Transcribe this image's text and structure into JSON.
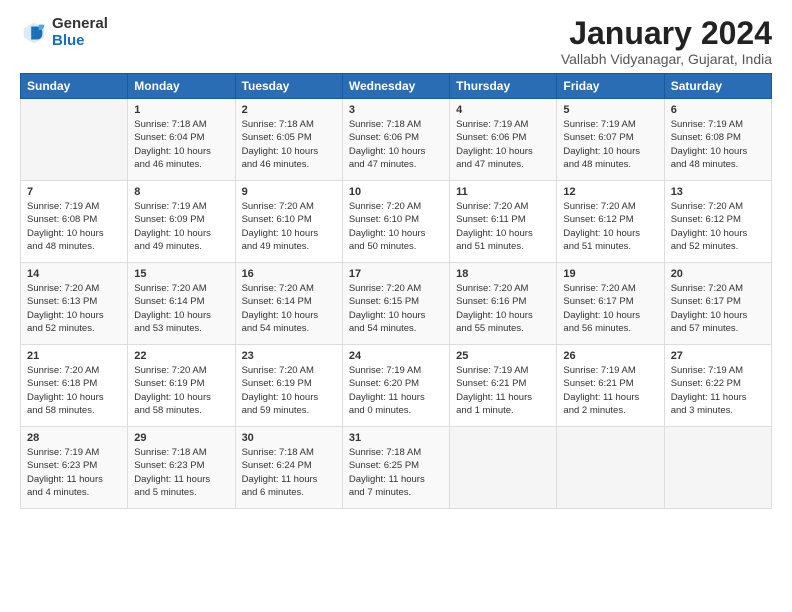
{
  "header": {
    "logo_general": "General",
    "logo_blue": "Blue",
    "title": "January 2024",
    "location": "Vallabh Vidyanagar, Gujarat, India"
  },
  "calendar": {
    "days_of_week": [
      "Sunday",
      "Monday",
      "Tuesday",
      "Wednesday",
      "Thursday",
      "Friday",
      "Saturday"
    ],
    "weeks": [
      [
        {
          "day": "",
          "info": ""
        },
        {
          "day": "1",
          "info": "Sunrise: 7:18 AM\nSunset: 6:04 PM\nDaylight: 10 hours and 46 minutes."
        },
        {
          "day": "2",
          "info": "Sunrise: 7:18 AM\nSunset: 6:05 PM\nDaylight: 10 hours and 46 minutes."
        },
        {
          "day": "3",
          "info": "Sunrise: 7:18 AM\nSunset: 6:06 PM\nDaylight: 10 hours and 47 minutes."
        },
        {
          "day": "4",
          "info": "Sunrise: 7:19 AM\nSunset: 6:06 PM\nDaylight: 10 hours and 47 minutes."
        },
        {
          "day": "5",
          "info": "Sunrise: 7:19 AM\nSunset: 6:07 PM\nDaylight: 10 hours and 48 minutes."
        },
        {
          "day": "6",
          "info": "Sunrise: 7:19 AM\nSunset: 6:08 PM\nDaylight: 10 hours and 48 minutes."
        }
      ],
      [
        {
          "day": "7",
          "info": "Sunrise: 7:19 AM\nSunset: 6:08 PM\nDaylight: 10 hours and 48 minutes."
        },
        {
          "day": "8",
          "info": "Sunrise: 7:19 AM\nSunset: 6:09 PM\nDaylight: 10 hours and 49 minutes."
        },
        {
          "day": "9",
          "info": "Sunrise: 7:20 AM\nSunset: 6:10 PM\nDaylight: 10 hours and 49 minutes."
        },
        {
          "day": "10",
          "info": "Sunrise: 7:20 AM\nSunset: 6:10 PM\nDaylight: 10 hours and 50 minutes."
        },
        {
          "day": "11",
          "info": "Sunrise: 7:20 AM\nSunset: 6:11 PM\nDaylight: 10 hours and 51 minutes."
        },
        {
          "day": "12",
          "info": "Sunrise: 7:20 AM\nSunset: 6:12 PM\nDaylight: 10 hours and 51 minutes."
        },
        {
          "day": "13",
          "info": "Sunrise: 7:20 AM\nSunset: 6:12 PM\nDaylight: 10 hours and 52 minutes."
        }
      ],
      [
        {
          "day": "14",
          "info": "Sunrise: 7:20 AM\nSunset: 6:13 PM\nDaylight: 10 hours and 52 minutes."
        },
        {
          "day": "15",
          "info": "Sunrise: 7:20 AM\nSunset: 6:14 PM\nDaylight: 10 hours and 53 minutes."
        },
        {
          "day": "16",
          "info": "Sunrise: 7:20 AM\nSunset: 6:14 PM\nDaylight: 10 hours and 54 minutes."
        },
        {
          "day": "17",
          "info": "Sunrise: 7:20 AM\nSunset: 6:15 PM\nDaylight: 10 hours and 54 minutes."
        },
        {
          "day": "18",
          "info": "Sunrise: 7:20 AM\nSunset: 6:16 PM\nDaylight: 10 hours and 55 minutes."
        },
        {
          "day": "19",
          "info": "Sunrise: 7:20 AM\nSunset: 6:17 PM\nDaylight: 10 hours and 56 minutes."
        },
        {
          "day": "20",
          "info": "Sunrise: 7:20 AM\nSunset: 6:17 PM\nDaylight: 10 hours and 57 minutes."
        }
      ],
      [
        {
          "day": "21",
          "info": "Sunrise: 7:20 AM\nSunset: 6:18 PM\nDaylight: 10 hours and 58 minutes."
        },
        {
          "day": "22",
          "info": "Sunrise: 7:20 AM\nSunset: 6:19 PM\nDaylight: 10 hours and 58 minutes."
        },
        {
          "day": "23",
          "info": "Sunrise: 7:20 AM\nSunset: 6:19 PM\nDaylight: 10 hours and 59 minutes."
        },
        {
          "day": "24",
          "info": "Sunrise: 7:19 AM\nSunset: 6:20 PM\nDaylight: 11 hours and 0 minutes."
        },
        {
          "day": "25",
          "info": "Sunrise: 7:19 AM\nSunset: 6:21 PM\nDaylight: 11 hours and 1 minute."
        },
        {
          "day": "26",
          "info": "Sunrise: 7:19 AM\nSunset: 6:21 PM\nDaylight: 11 hours and 2 minutes."
        },
        {
          "day": "27",
          "info": "Sunrise: 7:19 AM\nSunset: 6:22 PM\nDaylight: 11 hours and 3 minutes."
        }
      ],
      [
        {
          "day": "28",
          "info": "Sunrise: 7:19 AM\nSunset: 6:23 PM\nDaylight: 11 hours and 4 minutes."
        },
        {
          "day": "29",
          "info": "Sunrise: 7:18 AM\nSunset: 6:23 PM\nDaylight: 11 hours and 5 minutes."
        },
        {
          "day": "30",
          "info": "Sunrise: 7:18 AM\nSunset: 6:24 PM\nDaylight: 11 hours and 6 minutes."
        },
        {
          "day": "31",
          "info": "Sunrise: 7:18 AM\nSunset: 6:25 PM\nDaylight: 11 hours and 7 minutes."
        },
        {
          "day": "",
          "info": ""
        },
        {
          "day": "",
          "info": ""
        },
        {
          "day": "",
          "info": ""
        }
      ]
    ]
  }
}
